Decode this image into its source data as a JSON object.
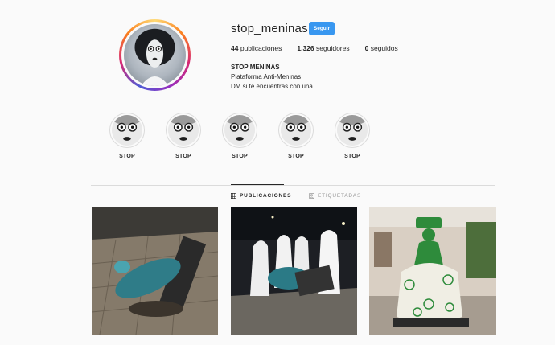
{
  "profile": {
    "username": "stop_meninas",
    "follow_label": "Seguir",
    "stats": {
      "posts_count": "44",
      "posts_label": "publicaciones",
      "followers_count": "1.326",
      "followers_label": "seguidores",
      "following_count": "0",
      "following_label": "seguidos"
    },
    "bio": {
      "name": "STOP MENINAS",
      "line1": "Plataforma Anti-Meninas",
      "line2": "DM si te encuentras con una"
    }
  },
  "highlights": [
    {
      "label": "STOP"
    },
    {
      "label": "STOP"
    },
    {
      "label": "STOP"
    },
    {
      "label": "STOP"
    },
    {
      "label": "STOP"
    }
  ],
  "tabs": {
    "publicaciones": "PUBLICACIONES",
    "etiquetadas": "ETIQUETADAS"
  },
  "colors": {
    "follow_button": "#3897f0",
    "background": "#fafafa",
    "text": "#262626",
    "muted": "#999999",
    "divider": "#dbdbdb"
  },
  "icons": {
    "publicaciones": "grid-icon",
    "etiquetadas": "tagged-icon"
  }
}
